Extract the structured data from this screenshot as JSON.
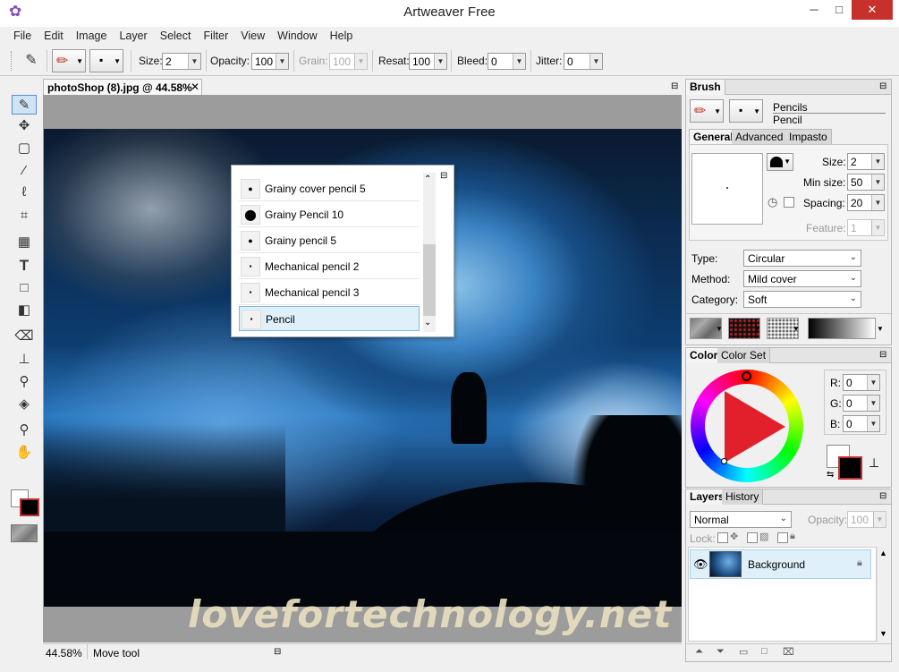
{
  "window": {
    "title": "Artweaver Free",
    "minimize": "─",
    "maximize": "□",
    "close": "✕"
  },
  "menu": [
    "File",
    "Edit",
    "Image",
    "Layer",
    "Select",
    "Filter",
    "View",
    "Window",
    "Help"
  ],
  "options": {
    "size_label": "Size:",
    "size_value": "2",
    "opacity_label": "Opacity:",
    "opacity_value": "100",
    "grain_label": "Grain:",
    "grain_value": "100",
    "resat_label": "Resat:",
    "resat_value": "100",
    "bleed_label": "Bleed:",
    "bleed_value": "0",
    "jitter_label": "Jitter:",
    "jitter_value": "0"
  },
  "document": {
    "tab_title": "photoShop (8).jpg @ 44.58%",
    "tab_close": "✕",
    "watermark": "lovefortechnology.net",
    "zoom": "44.58%",
    "status": "Move tool"
  },
  "brush_popup": {
    "items": [
      {
        "label": "Grainy cover pencil 5",
        "dot": "●"
      },
      {
        "label": "Grainy Pencil 10",
        "dot": "⬤"
      },
      {
        "label": "Grainy pencil 5",
        "dot": "●"
      },
      {
        "label": "Mechanical pencil 2",
        "dot": "▪"
      },
      {
        "label": "Mechanical pencil 3",
        "dot": "▪"
      },
      {
        "label": "Pencil",
        "dot": "▪"
      }
    ]
  },
  "brush_panel": {
    "title": "Brush",
    "category_name": "Pencils",
    "variant_name": "Pencil",
    "tabs": [
      "General",
      "Advanced",
      "Impasto"
    ],
    "size_label": "Size:",
    "size_value": "2",
    "minsize_label": "Min size:",
    "minsize_value": "50",
    "spacing_label": "Spacing:",
    "spacing_value": "20",
    "feature_label": "Feature:",
    "feature_value": "1",
    "type_label": "Type:",
    "type_value": "Circular",
    "method_label": "Method:",
    "method_value": "Mild cover",
    "category_label": "Category:",
    "category_value": "Soft"
  },
  "color_panel": {
    "tabs": [
      "Color",
      "Color Set"
    ],
    "r_label": "R:",
    "r_value": "0",
    "g_label": "G:",
    "g_value": "0",
    "b_label": "B:",
    "b_value": "0"
  },
  "layers_panel": {
    "tabs": [
      "Layers",
      "History"
    ],
    "blend_mode": "Normal",
    "opacity_label": "Opacity:",
    "opacity_value": "100",
    "lock_label": "Lock:",
    "layer_name": "Background"
  },
  "colors": {
    "accent": "#5b8fc7",
    "selection": "#dff0fb",
    "close_red": "#c7312b"
  }
}
